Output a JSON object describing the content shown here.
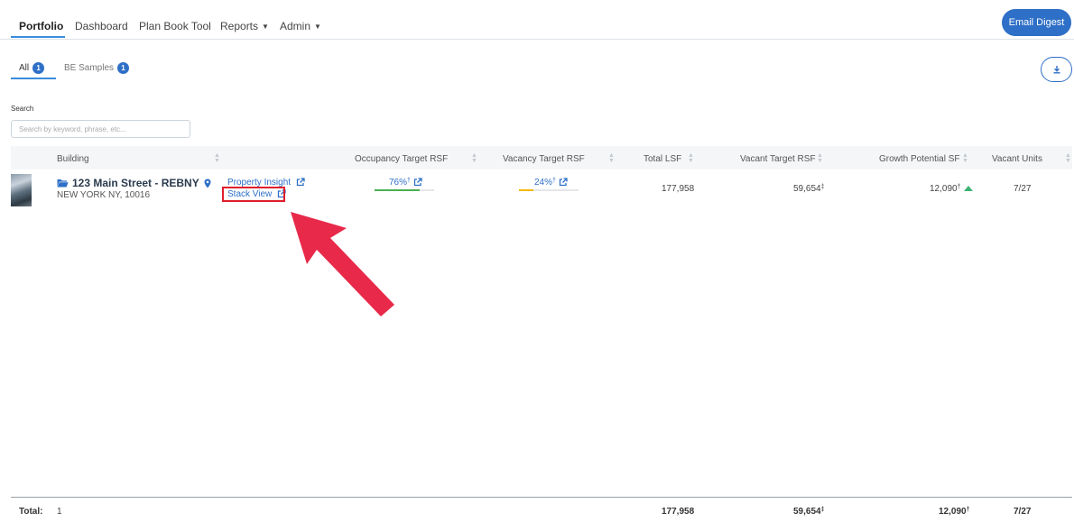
{
  "nav": {
    "items": [
      {
        "label": "Portfolio"
      },
      {
        "label": "Dashboard"
      },
      {
        "label": "Plan Book Tool"
      },
      {
        "label": "Reports"
      },
      {
        "label": "Admin"
      }
    ],
    "email_button": "Email Digest"
  },
  "tabs": [
    {
      "label": "All",
      "count": "1"
    },
    {
      "label": "BE Samples",
      "count": "1"
    }
  ],
  "search": {
    "label": "Search",
    "placeholder": "Search by keyword, phrase, etc..."
  },
  "table": {
    "headers": [
      "Building",
      "",
      "Occupancy Target RSF",
      "Vacancy Target RSF",
      "Total LSF",
      "Vacant Target RSF",
      "Growth Potential SF",
      "Vacant Units"
    ],
    "row": {
      "name": "123 Main Street - REBNY",
      "address": "NEW YORK NY, 10016",
      "link1": "Property Insight",
      "link2": "Stack View",
      "occupancy": "76%",
      "occupancy_value": 0.76,
      "vacancy": "24%",
      "vacancy_value": 0.24,
      "total_lsf": "177,958",
      "vacant_target_rsf": "59,654",
      "growth_potential": "12,090",
      "vacant_units": "7/27"
    },
    "footer": {
      "label": "Total:",
      "count": "1",
      "total_lsf": "177,958",
      "vacant_target_rsf": "59,654",
      "growth_potential": "12,090",
      "vacant_units": "7/27"
    }
  },
  "colors": {
    "accent": "#2e6fc7",
    "occupancy_bar": "#4caf50",
    "vacancy_bar": "#f5b800",
    "highlight": "#e01e2b",
    "arrow": "#e8294a"
  }
}
